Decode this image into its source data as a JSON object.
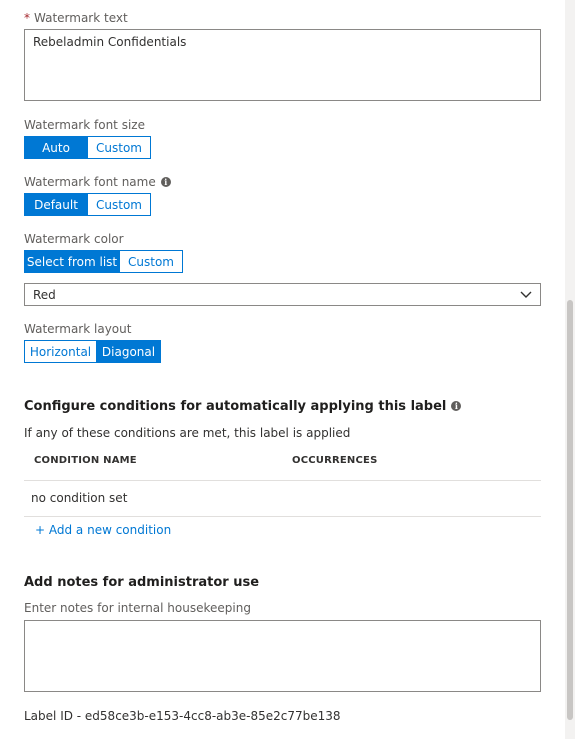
{
  "watermark_text": {
    "required_mark": "*",
    "label": "Watermark text",
    "value": "Rebeladmin Confidentials"
  },
  "font_size": {
    "label": "Watermark font size",
    "options": [
      "Auto",
      "Custom"
    ],
    "selected": "Auto"
  },
  "font_name": {
    "label": "Watermark font name",
    "info_icon": "info-icon",
    "options": [
      "Default",
      "Custom"
    ],
    "selected": "Default"
  },
  "color": {
    "label": "Watermark color",
    "options": [
      "Select from list",
      "Custom"
    ],
    "selected": "Select from list",
    "dropdown_value": "Red"
  },
  "layout": {
    "label": "Watermark layout",
    "options": [
      "Horizontal",
      "Diagonal"
    ],
    "selected": "Diagonal"
  },
  "conditions": {
    "title": "Configure conditions for automatically applying this label",
    "info_icon": "info-icon",
    "description": "If any of these conditions are met, this label is applied",
    "columns": [
      "CONDITION NAME",
      "OCCURRENCES"
    ],
    "empty_text": "no condition set",
    "add_link": "+ Add a new condition"
  },
  "notes": {
    "title": "Add notes for administrator use",
    "placeholder_label": "Enter notes for internal housekeeping",
    "value": ""
  },
  "label_id": {
    "text": "Label ID - ed58ce3b-e153-4cc8-ab3e-85e2c77be138"
  },
  "colors": {
    "accent": "#0078d4",
    "required": "#a4262c",
    "border": "#8a8886"
  }
}
